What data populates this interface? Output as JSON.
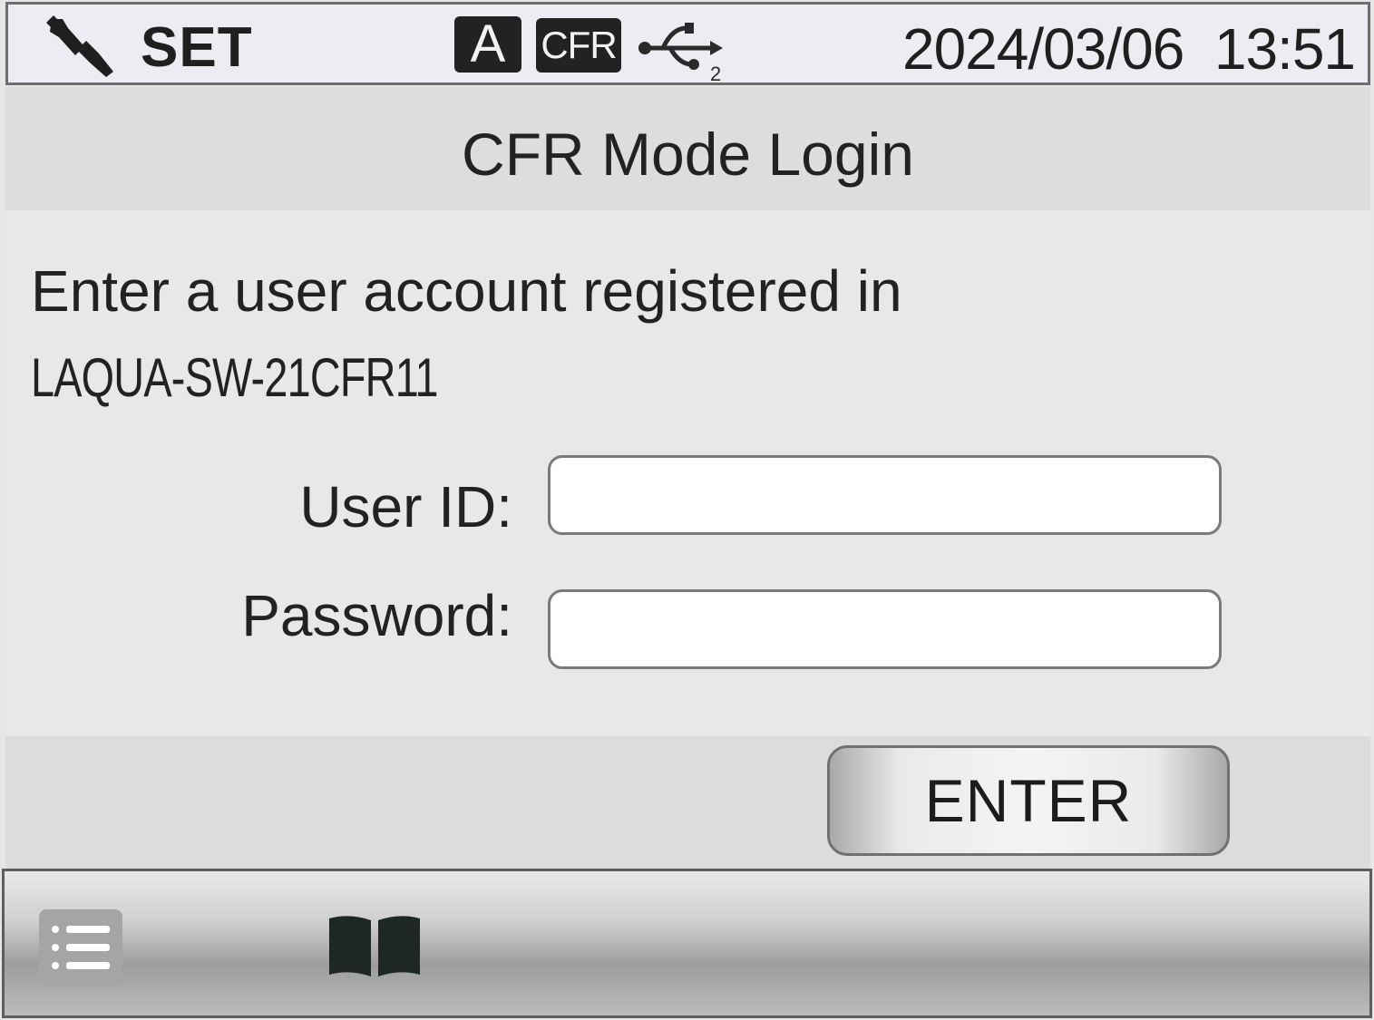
{
  "status_bar": {
    "mode_label": "SET",
    "mode_icon": "wrench-icon",
    "auto_indicator": "A",
    "cfr_indicator": "CFR",
    "usb_icon": "usb-icon",
    "usb_port": "2",
    "date": "2024/03/06",
    "time": "13:51"
  },
  "page": {
    "title": "CFR Mode Login",
    "instruction_line1": "Enter a user account registered in",
    "instruction_line2": "LAQUA-SW-21CFR11"
  },
  "form": {
    "user_id_label": "User ID:",
    "user_id_value": "",
    "password_label": "Password:",
    "password_value": ""
  },
  "actions": {
    "enter_label": "ENTER"
  },
  "bottom_bar": {
    "menu_icon": "list-menu-icon",
    "manual_icon": "book-icon"
  },
  "colors": {
    "background": "#e6e6e6",
    "status_bar": "#ececf2",
    "indicator_bg": "#222222",
    "input_bg": "#ffffff"
  }
}
